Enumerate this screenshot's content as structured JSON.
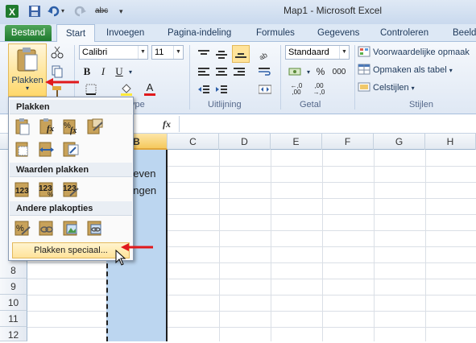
{
  "window": {
    "title": "Map1  -  Microsoft Excel"
  },
  "tabs": [
    "Bestand",
    "Start",
    "Invoegen",
    "Pagina-indeling",
    "Formules",
    "Gegevens",
    "Controleren",
    "Beeld"
  ],
  "ribbon": {
    "paste_label": "Plakken",
    "font_name": "Calibri",
    "font_size": "11",
    "number_format": "Standaard",
    "bold": "B",
    "italic": "I",
    "underline": "U",
    "percent": "%",
    "thousands": "000",
    "cond_format": "Voorwaardelijke opmaak",
    "format_table": "Opmaken als tabel",
    "cell_styles": "Celstijlen",
    "groups": {
      "font": "ype",
      "alignment": "Uitlijning",
      "number": "Getal",
      "styles": "Stijlen"
    }
  },
  "formula_bar": {
    "fx": "fx"
  },
  "columns": [
    "B",
    "C",
    "D",
    "E",
    "F",
    "G",
    "H"
  ],
  "rows": [
    "8",
    "9",
    "10",
    "11",
    "12"
  ],
  "cells": {
    "b_line1": "oeven",
    "b_line2": "ongen"
  },
  "paste_menu": {
    "sections": [
      "Plakken",
      "Waarden plakken",
      "Andere plakopties"
    ],
    "paste_special": "Plakken speciaal..."
  },
  "colors": {
    "accent_green": "#2a8b3a",
    "selection": "#bcd6f0",
    "highlight": "#ffe39a",
    "arrow": "#e0191c"
  }
}
